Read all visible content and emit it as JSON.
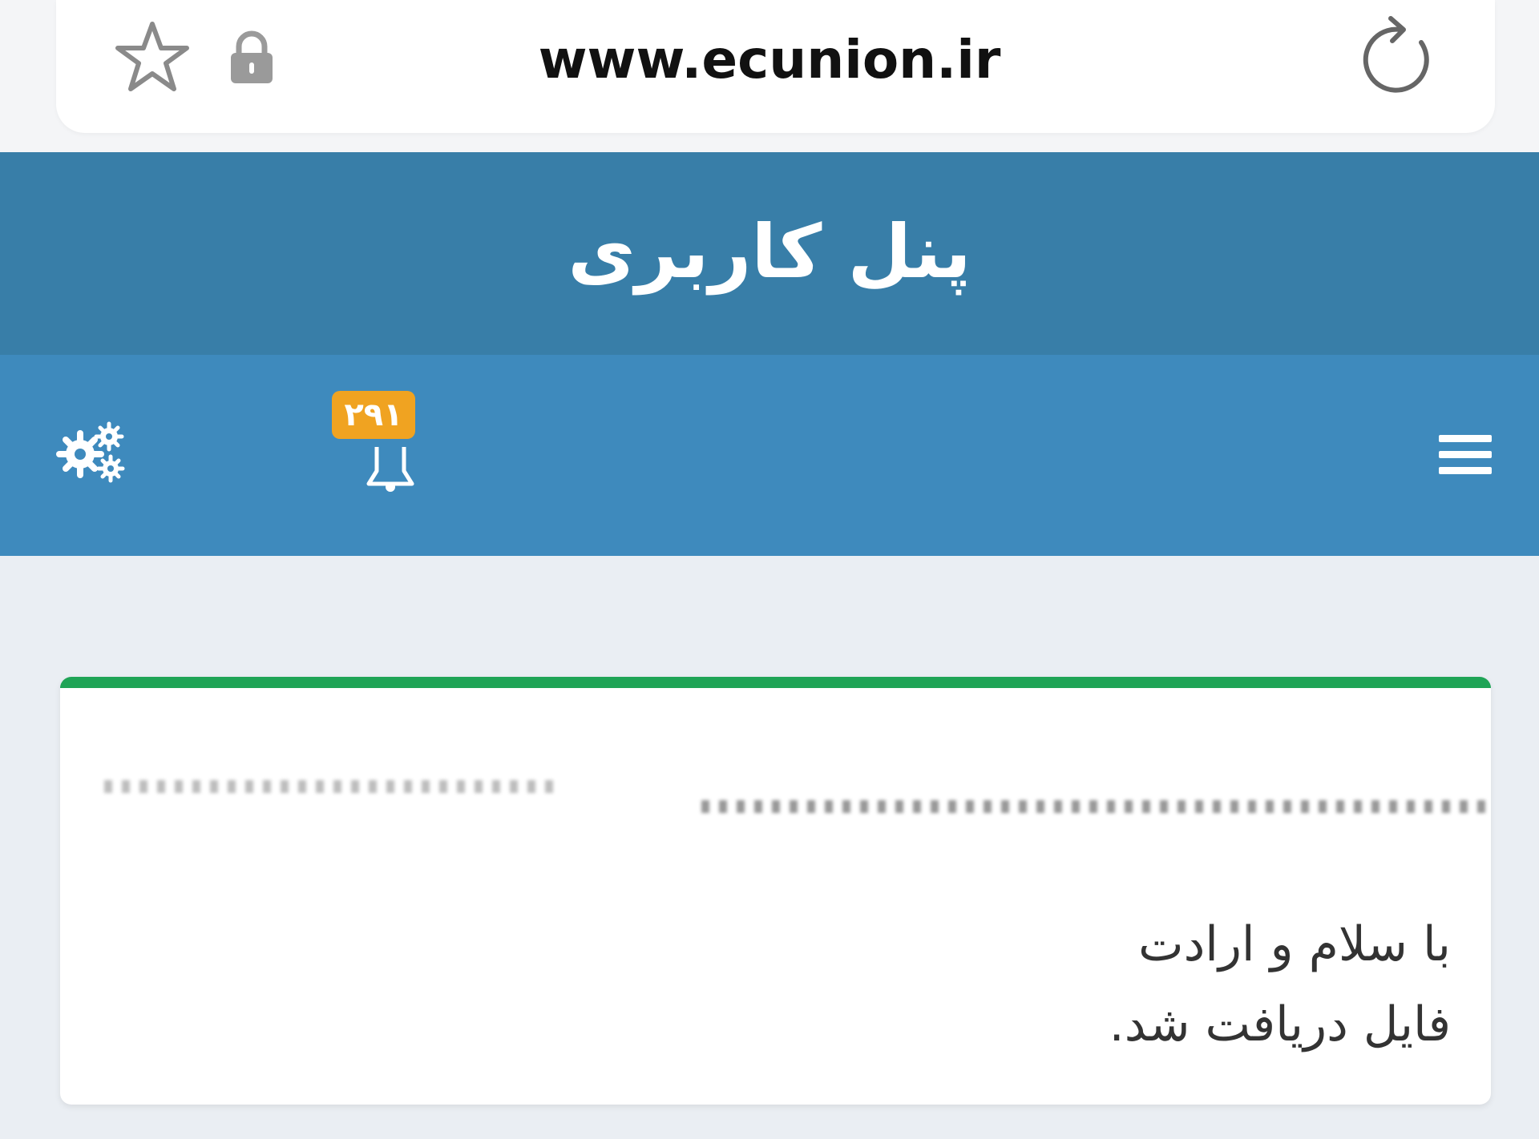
{
  "browser": {
    "url": "www.ecunion.ir"
  },
  "header": {
    "title": "پنل کاربری"
  },
  "toolbar": {
    "notification_count": "۲۹۱"
  },
  "message": {
    "line1": "با سلام و ارادت",
    "line2": "فایل دریافت شد."
  },
  "colors": {
    "header": "#387ea8",
    "toolbar": "#3e8abd",
    "badge": "#f0a321",
    "card_accent": "#1fa456"
  }
}
